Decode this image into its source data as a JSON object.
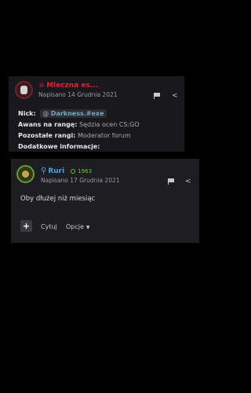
{
  "post_1": {
    "author": "Mleczna es...",
    "author_icon": "skull-icon",
    "date": "Napisano 14 Grudnia 2021",
    "fields": {
      "nick_label": "Nick:",
      "nick_prefix": "@",
      "nick_value": "Darkness.#exe",
      "rank_label": "Awans na rangę:",
      "rank_value": "Sędzia ocen CS:GO",
      "other_label": "Pozostałe rangi:",
      "other_value": "Moderator forum",
      "extra_label": "Dodatkowe informacje:"
    },
    "accent": "#e0232e"
  },
  "post_2": {
    "author": "Ruri",
    "author_icon": "search-icon",
    "reputation": "1963",
    "date": "Napisano 17 Grudnia 2021",
    "content": "Oby dłużej niż miesiąc",
    "actions": {
      "plus": "+",
      "quote": "Cytuj",
      "options": "Opcje",
      "options_icon": "chevron-down-icon"
    },
    "accent": "#4aa3e0",
    "reputation_color": "#66c14a"
  }
}
